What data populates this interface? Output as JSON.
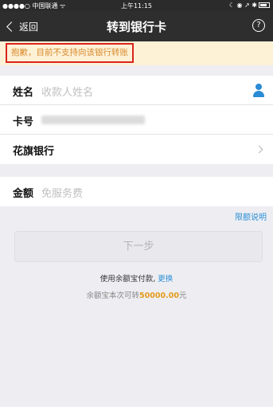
{
  "status_bar": {
    "carrier": "●●●●○ 中国联通 ᯤ",
    "time": "上午11:15",
    "indicators": "☾ ◉ ↗ ✱"
  },
  "nav": {
    "back_label": "返回",
    "title": "转到银行卡",
    "help_symbol": "?"
  },
  "warning": {
    "text": "抱歉，目前不支持向该银行转账",
    "highlight_color": "#d9251c"
  },
  "form": {
    "name_label": "姓名",
    "name_placeholder": "收款人姓名",
    "card_label": "卡号",
    "bank_name": "花旗银行",
    "amount_label": "金额",
    "amount_placeholder": "免服务费"
  },
  "limit_link": "限额说明",
  "next_button": "下一步",
  "payment": {
    "text": "使用余额宝付款,",
    "change_link": "更换"
  },
  "quota": {
    "prefix": "余额宝本次可转",
    "amount": "50000.00",
    "suffix": "元"
  },
  "colors": {
    "accent": "#2d8fd6",
    "amount": "#e39a1c",
    "nav_bg": "#2e2e2e"
  }
}
